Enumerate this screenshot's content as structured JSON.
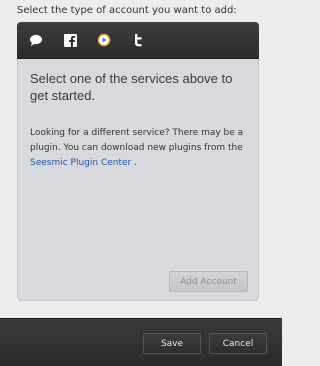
{
  "prompt": "Select the type of account you want to add:",
  "tabs": [
    {
      "icon": "chat-bubble-icon"
    },
    {
      "icon": "facebook-icon"
    },
    {
      "icon": "play-circle-icon"
    },
    {
      "icon": "twitter-icon"
    }
  ],
  "content": {
    "headline": "Select one of the services above to get started.",
    "desc_prefix": "Looking for a different service? There may be a plugin. You can download new plugins from the ",
    "link_text": "Seesmic Plugin Center",
    "desc_suffix": " ."
  },
  "add_account_label": "Add Account",
  "footer": {
    "save_label": "Save",
    "cancel_label": "Cancel"
  },
  "colors": {
    "link": "#2058a8",
    "panel_bg": "#d8d9dc",
    "tabbar_bg": "#2c2c2c"
  }
}
